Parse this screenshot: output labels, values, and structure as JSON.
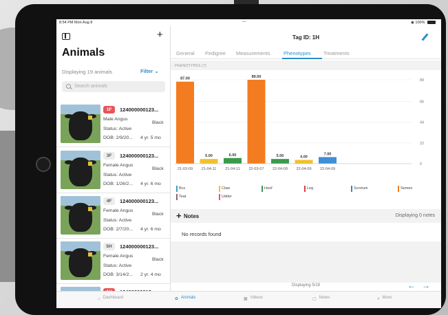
{
  "statusbar": {
    "time": "8:54 PM  Mon Aug 8",
    "dots": "•••",
    "battery": "100%"
  },
  "left": {
    "title": "Animals",
    "display_count": "Displaying 19 animals",
    "filter_label": "Filter",
    "search_placeholder": "Search animals",
    "animals": [
      {
        "tag": "1F",
        "tag_color": "#e8545a",
        "id": "124000000123...",
        "desc": "Male Angus",
        "color": "Black",
        "status": "Status: Active",
        "dob": "DOB: 2/9/20...",
        "age": "4 yr. 5 mo"
      },
      {
        "tag": "3F",
        "tag_color": "#ececec",
        "id": "124000000123...",
        "desc": "Female Angus",
        "color": "Black",
        "status": "Status: Active",
        "dob": "DOB: 1/26/2...",
        "age": "4 yr. 6 mo"
      },
      {
        "tag": "4F",
        "tag_color": "#ececec",
        "id": "124000000123...",
        "desc": "Female Angus",
        "color": "Black",
        "status": "Status: Active",
        "dob": "DOB: 2/7/20...",
        "age": "4 yr. 6 mo"
      },
      {
        "tag": "5H",
        "tag_color": "#ececec",
        "id": "124000000123...",
        "desc": "Female Angus",
        "color": "Black",
        "status": "Status: Active",
        "dob": "DOB: 3/14/2...",
        "age": "2 yr. 4 mo"
      },
      {
        "tag": "1H",
        "tag_color": "#e8545a",
        "id": "12400000012..."
      }
    ]
  },
  "right": {
    "title": "Tag ID: 1H",
    "tabs": [
      "General",
      "Pedigree",
      "Measurements",
      "Phenotypes",
      "Treatments"
    ],
    "active_tab": "Phenotypes",
    "section_header": "PHENOTYPES (7)",
    "notes_title": "Notes",
    "notes_count": "Displaying 0 notes",
    "no_records": "No records found",
    "pager_text": "Displaying 5/19"
  },
  "chart_data": {
    "type": "bar",
    "categories": [
      "21-03-09",
      "21-04-11",
      "21-04-11",
      "22-03-07",
      "22-04-09",
      "22-04-09",
      "22-04-09"
    ],
    "values": [
      87.0,
      5.0,
      6.0,
      89.0,
      5.0,
      4.0,
      7.0
    ],
    "data_labels": [
      "87.00",
      "5.00",
      "6.00",
      "89.00",
      "5.00",
      "4.00",
      "7.00"
    ],
    "bar_colors": [
      "#f47c20",
      "#f2c02e",
      "#3a9a4a",
      "#f47c20",
      "#3a9a4a",
      "#f2c02e",
      "#3f8fd8"
    ],
    "yticks": [
      0,
      22,
      44,
      66,
      89
    ],
    "ylim": [
      0,
      89
    ],
    "y_axis_side": "right",
    "grid": true,
    "legend": [
      {
        "name": "Bcs",
        "color": "#3aa0b8"
      },
      {
        "name": "Claw",
        "color": "#f2c02e"
      },
      {
        "name": "Hoof",
        "color": "#3a9a4a"
      },
      {
        "name": "Leg",
        "color": "#e23b3b"
      },
      {
        "name": "Scrotum",
        "color": "#2a8ec9"
      },
      {
        "name": "Semen",
        "color": "#f47c20"
      },
      {
        "name": "Teat",
        "color": "#8a6a6a"
      },
      {
        "name": "Udder",
        "color": "#e8547a"
      }
    ]
  },
  "tabbar": [
    "Dashboard",
    "Animals",
    "Videos",
    "Notes",
    "More"
  ],
  "tabbar_active": "Animals",
  "accent_color": "#2a8ec9"
}
